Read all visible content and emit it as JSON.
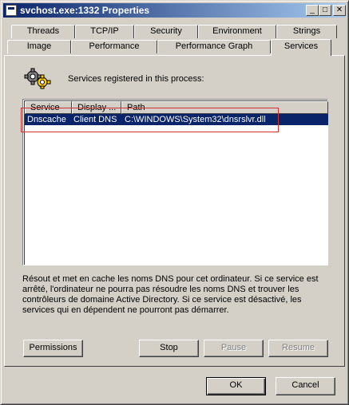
{
  "window": {
    "title": "svchost.exe:1332 Properties",
    "controls": {
      "minimize": "_",
      "maximize": "□",
      "close": "✕"
    }
  },
  "tabs": {
    "row_back": [
      "Threads",
      "TCP/IP",
      "Security",
      "Environment",
      "Strings"
    ],
    "row_front": [
      "Image",
      "Performance",
      "Performance Graph",
      "Services"
    ],
    "active": "Services"
  },
  "services_panel": {
    "label": "Services registered in this process:",
    "icon": "gear-icon",
    "columns": [
      "Service",
      "Display ...",
      "Path"
    ],
    "rows": [
      {
        "service": "Dnscache",
        "display": "Client DNS",
        "path": "C:\\WINDOWS\\System32\\dnsrslvr.dll"
      }
    ],
    "description": "Résout et met en cache les noms DNS pour cet ordinateur. Si ce service est arrêté, l'ordinateur ne pourra pas résoudre les noms DNS et trouver les contrôleurs de domaine Active Directory. Si ce service est désactivé, les services qui en dépendent ne pourront pas démarrer.",
    "buttons": {
      "permissions": "Permissions",
      "stop": "Stop",
      "pause": "Pause",
      "resume": "Resume"
    }
  },
  "footer": {
    "ok": "OK",
    "cancel": "Cancel"
  },
  "colors": {
    "highlight_box": "#d03030",
    "selection": "#0a246a",
    "face": "#d4d0c8"
  }
}
